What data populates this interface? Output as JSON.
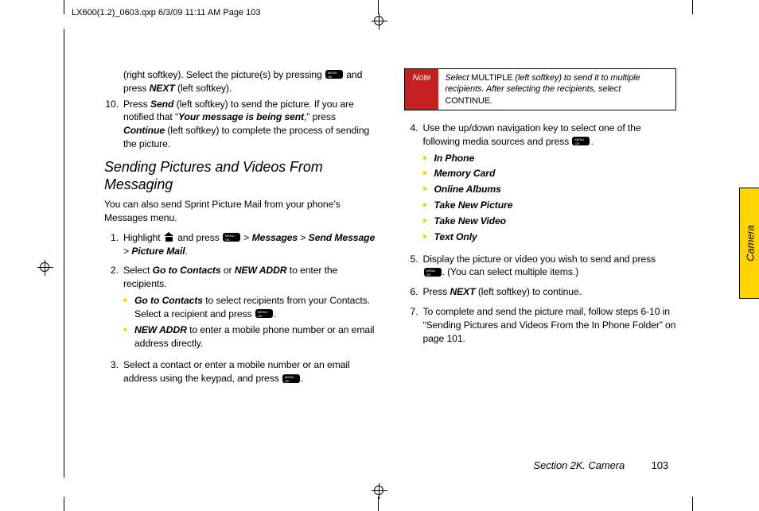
{
  "meta": {
    "file_header": "LX600(1.2)_0603.qxp  6/3/09  11:11 AM  Page 103"
  },
  "left": {
    "fragment1": "(right softkey). Select the picture(s) by pressing ",
    "fragment1b": " and press ",
    "fragment1_next": "NEXT",
    "fragment1c": " (left softkey).",
    "step10_num": "10.",
    "step10_a": "Press ",
    "step10_send": "Send",
    "step10_b": " (left softkey) to send the picture. If you are notified that “",
    "step10_msg": "Your message is being sent",
    "step10_c": ",” press ",
    "step10_cont": "Continue",
    "step10_d": " (left softkey) to complete the process of sending the picture.",
    "heading": "Sending Pictures and Videos From Messaging",
    "intro": "You can also send Sprint Picture Mail from your phone’s Messages menu.",
    "s1_num": "1.",
    "s1_a": "Highlight ",
    "s1_b": " and press ",
    "s1_c": " > ",
    "s1_path1": "Messages",
    "s1_path2": "Send Message",
    "s1_path3": "Picture Mail",
    "s1_d": ".",
    "s2_num": "2.",
    "s2_a": "Select ",
    "s2_goto": "Go to Contacts",
    "s2_b": " or ",
    "s2_new": "NEW ADDR",
    "s2_c": " to enter the recipients.",
    "s2_sub1_a": "Go to Contacts",
    "s2_sub1_b": "  to select recipients from your Contacts. Select a recipient and press ",
    "s2_sub1_c": ".",
    "s2_sub2_a": "NEW ADDR",
    "s2_sub2_b": "  to enter a mobile phone number or an email address directly.",
    "s3_num": "3.",
    "s3_a": "Select a contact or enter a mobile number or an email address using the keypad, and press ",
    "s3_b": "."
  },
  "right": {
    "note_label": "Note",
    "note_a": "Select ",
    "note_mult": "MULTIPLE",
    "note_b": " (left softkey) to send it to multiple recipients. After selecting the recipients, select ",
    "note_cont": "CONTINUE",
    "note_c": ".",
    "s4_num": "4.",
    "s4_a": "Use the up/down navigation key to select one of the following media sources and press ",
    "s4_b": ".",
    "media": {
      "m1": "In Phone",
      "m2": "Memory Card",
      "m3": "Online Albums",
      "m4": "Take New Picture",
      "m5": "Take New Video",
      "m6": "Text Only"
    },
    "s5_num": "5.",
    "s5_a": "Display the picture or video you wish to send and press ",
    "s5_b": ". (You can select multiple items.)",
    "s6_num": "6.",
    "s6_a": " Press ",
    "s6_next": "NEXT",
    "s6_b": " (left softkey) to continue.",
    "s7_num": "7.",
    "s7_a": " To complete and send the picture mail, follow steps 6-10 in “Sending Pictures and Videos From the In Phone Folder” on page 101."
  },
  "footer": {
    "section": "Section 2K. Camera",
    "page": "103"
  },
  "tab": {
    "label": "Camera"
  }
}
